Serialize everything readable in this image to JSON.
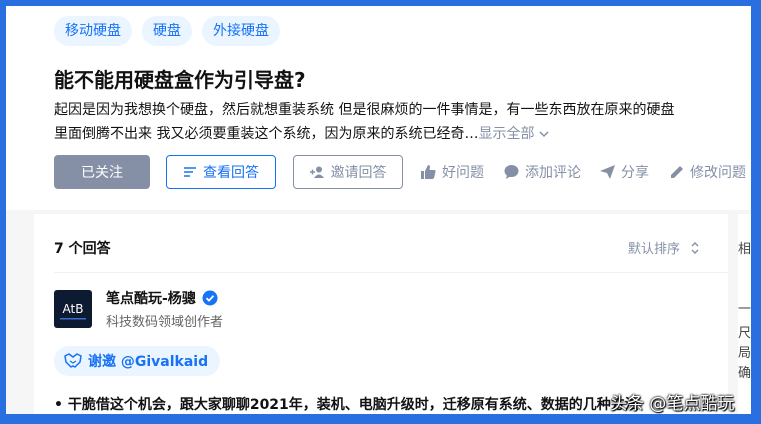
{
  "tags": [
    "移动硬盘",
    "硬盘",
    "外接硬盘"
  ],
  "question": {
    "title": "能不能用硬盘盒作为引导盘?",
    "desc_line1": "起因是因为我想换个硬盘，然后就想重装系统 但是很麻烦的一件事情是，有一些东西放在原来的硬盘",
    "desc_line2": "里面倒腾不出来 我又必须要重装这个系统，因为原来的系统已经奇…",
    "show_all": "显示全部"
  },
  "actions": {
    "follow": "已关注",
    "view_answers": "查看回答",
    "invite": "邀请回答",
    "good_question": "好问题",
    "comment": "添加评论",
    "share": "分享",
    "edit": "修改问题"
  },
  "answers": {
    "count": "7 个回答",
    "sort": "默认排序"
  },
  "answer": {
    "avatar_text": "AtB",
    "author": "笔点酷玩-杨骢",
    "bio": "科技数码领域创作者",
    "thanks": "谢邀 @Givalkaid",
    "excerpt": "• 干脆借这个机会，跟大家聊聊2021年，装机、电脑升级时，迁移原有系统、数据的几种方法"
  },
  "sidebar_chars": [
    "相",
    "一",
    "尺",
    "局",
    "确"
  ],
  "watermark": "头条 @笔点酷玩",
  "colors": {
    "accent": "#1772f6",
    "muted": "#8590a6",
    "frame": "#2a6fe0"
  }
}
